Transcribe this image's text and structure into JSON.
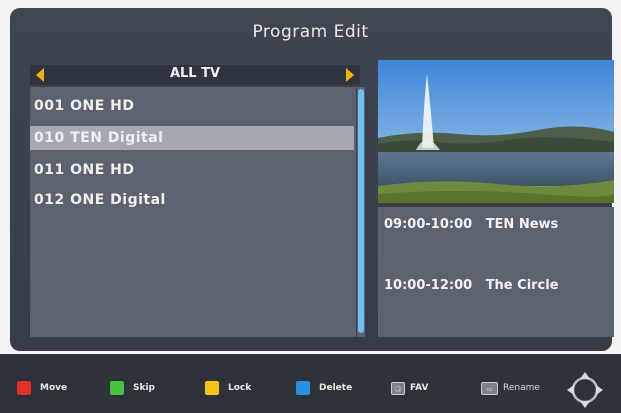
{
  "header": {
    "title": "Program Edit"
  },
  "category": {
    "label": "ALL TV"
  },
  "channels": [
    {
      "label": "001 ONE HD"
    },
    {
      "label": "010 TEN Digital"
    },
    {
      "label": "011 ONE HD"
    },
    {
      "label": "012 ONE Digital"
    }
  ],
  "selected_channel_index": 1,
  "epg": [
    {
      "time": "09:00-10:00",
      "title": "TEN News"
    },
    {
      "time": "10:00-12:00",
      "title": "The Circle"
    }
  ],
  "legend": [
    {
      "label": "Move",
      "color": "#e2302b"
    },
    {
      "label": "Skip",
      "color": "#49c13d"
    },
    {
      "label": "Lock",
      "color": "#f3c412"
    },
    {
      "label": "Delete",
      "color": "#2a8fe0"
    },
    {
      "label": "FAV",
      "icon": "fav-key-icon"
    },
    {
      "label": "Rename",
      "icon": "rename-key-icon"
    }
  ],
  "colors": {
    "accent_arrow": "#f5b20f",
    "scrollbar": "#6fc2f0",
    "panel": "#5b6270",
    "background": "#3f4652"
  },
  "icons": [
    "arrow-left-icon",
    "arrow-right-icon",
    "navigation-dpad-icon"
  ]
}
